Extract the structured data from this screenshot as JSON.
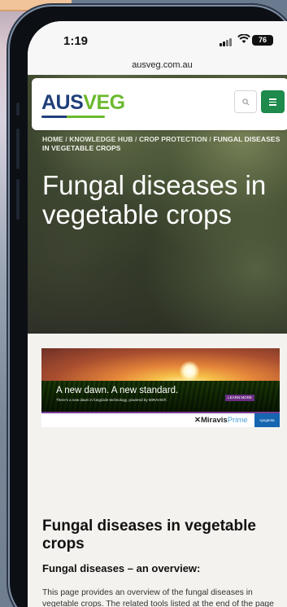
{
  "status_bar": {
    "time": "1:19",
    "battery": "76"
  },
  "browser": {
    "url": "ausveg.com.au"
  },
  "header": {
    "logo_text_1": "AUS",
    "logo_text_2": "VEG"
  },
  "breadcrumb": {
    "items": [
      "HOME",
      "KNOWLEDGE HUB",
      "CROP PROTECTION"
    ],
    "separator": " / ",
    "current": "FUNGAL DISEASES IN VEGETABLE CROPS"
  },
  "hero": {
    "title": "Fungal diseases in vegetable crops"
  },
  "ad": {
    "headline": "A new dawn. A new standard.",
    "subline": "There's a new dawn in fungicide technology, powered by MIRAVIS®.",
    "cta": "LEARN MORE",
    "brand_1": "Miravis",
    "brand_2": "Prime",
    "sponsor": "syngenta"
  },
  "content": {
    "heading": "Fungal diseases in vegetable crops",
    "subheading": "Fungal diseases – an overview:",
    "paragraph": "This page provides an overview of the fungal diseases in vegetable crops. The related tools listed at the end of the page provided detailed information about identification,"
  },
  "colors": {
    "brand_blue": "#1f3f7a",
    "brand_green": "#6bb92e",
    "menu_green": "#1e8a4c"
  },
  "icons": {
    "search": "search-icon",
    "menu": "hamburger-menu-icon",
    "wifi": "wifi-icon",
    "signal": "signal-icon",
    "battery": "battery-icon"
  }
}
